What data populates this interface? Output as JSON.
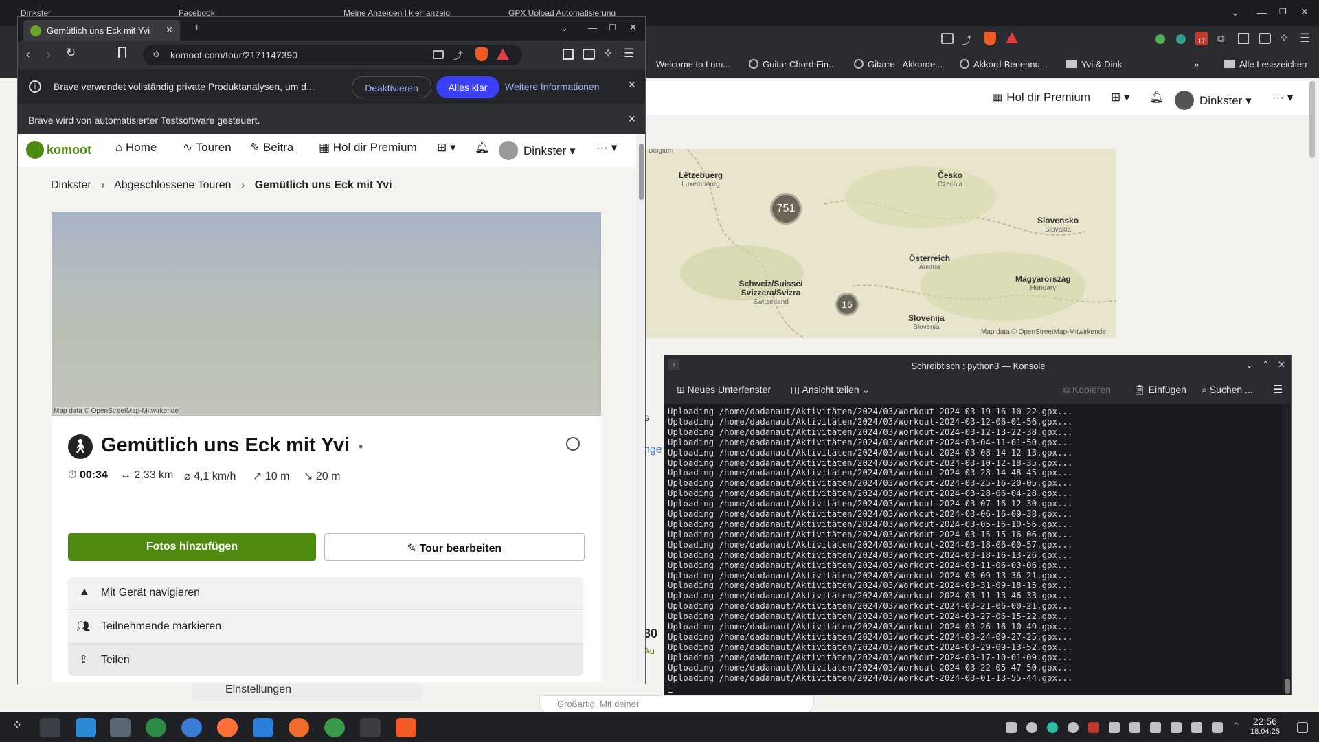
{
  "bg_browser": {
    "tabs": [
      "Dinkster",
      "Facebook",
      "Meine Anzeigen | kleinanzeig",
      "GPX Upload Automatisierung"
    ],
    "bookmarks": [
      "Welcome to Lum...",
      "Guitar Chord Fin...",
      "Gitarre - Akkorde...",
      "Akkord-Benennu...",
      "Yvi & Dink",
      "Alle Lesezeichen"
    ],
    "header": {
      "premium": "Hol dir Premium",
      "user": "Dinkster"
    },
    "map": {
      "countries": [
        {
          "name": "Lëtzebuerg",
          "sub": "Luxembourg"
        },
        {
          "name": "Česko",
          "sub": "Czechia"
        },
        {
          "name": "Slovensko",
          "sub": "Slovakia"
        },
        {
          "name": "Österreich",
          "sub": "Austria"
        },
        {
          "name": "Magyarország",
          "sub": "Hungary"
        },
        {
          "name": "Schweiz/Suisse/ Svizzera/Svizra",
          "sub": "Switzerland"
        },
        {
          "name": "Slovenija",
          "sub": "Slovenia"
        },
        {
          "name": "",
          "sub": "Belgium"
        }
      ],
      "clusters": [
        "751",
        "16"
      ],
      "attribution": "Map data © OpenStreetMap-Mitwirkende"
    },
    "partial": {
      "s": "s",
      "nge": "nge",
      "n30": "30",
      "au": "Au",
      "einstellungen": "Einstellungen",
      "grossartig": "Großartig. Mit deiner"
    }
  },
  "fg_browser": {
    "tab_title": "Gemütlich uns Eck mit Yvi",
    "url": "komoot.com/tour/2171147390",
    "badge": "",
    "info_bar": {
      "text": "Brave verwendet vollständig private Produktanalysen, um d...",
      "deactivate": "Deaktivieren",
      "ok": "Alles klar",
      "more": "Weitere Informationen"
    },
    "automation_bar": "Brave wird von automatisierter Testsoftware gesteuert.",
    "nav": {
      "brand": "komoot",
      "home": "Home",
      "tours": "Touren",
      "posts": "Beitra",
      "premium": "Hol dir Premium",
      "user": "Dinkster"
    },
    "breadcrumb": [
      "Dinkster",
      "Abgeschlossene Touren",
      "Gemütlich uns Eck mit Yvi"
    ],
    "map_attribution": "Map data © OpenStreetMap-Mitwirkende",
    "tour": {
      "title": "Gemütlich uns Eck mit Yvi",
      "duration": "00:34",
      "distance": "2,33 km",
      "speed": "4,1 km/h",
      "up": "10 m",
      "down": "20 m"
    },
    "buttons": {
      "add_photos": "Fotos hinzufügen",
      "edit_tour": "Tour bearbeiten"
    },
    "actions": [
      "Mit Gerät navigieren",
      "Teilnehmende markieren",
      "Teilen"
    ]
  },
  "konsole": {
    "title": "Schreibtisch : python3 — Konsole",
    "toolbar": {
      "new_tab": "Neues Unterfenster",
      "split": "Ansicht teilen",
      "copy": "Kopieren",
      "paste": "Einfügen",
      "search": "Suchen ..."
    },
    "lines": [
      "Uploading /home/dadanaut/Aktivitäten/2024/03/Workout-2024-03-19-16-10-22.gpx...",
      "Uploading /home/dadanaut/Aktivitäten/2024/03/Workout-2024-03-12-06-01-56.gpx...",
      "Uploading /home/dadanaut/Aktivitäten/2024/03/Workout-2024-03-12-13-22-38.gpx...",
      "Uploading /home/dadanaut/Aktivitäten/2024/03/Workout-2024-03-04-11-01-50.gpx...",
      "Uploading /home/dadanaut/Aktivitäten/2024/03/Workout-2024-03-08-14-12-13.gpx...",
      "Uploading /home/dadanaut/Aktivitäten/2024/03/Workout-2024-03-10-12-18-35.gpx...",
      "Uploading /home/dadanaut/Aktivitäten/2024/03/Workout-2024-03-28-14-48-45.gpx...",
      "Uploading /home/dadanaut/Aktivitäten/2024/03/Workout-2024-03-25-16-20-05.gpx...",
      "Uploading /home/dadanaut/Aktivitäten/2024/03/Workout-2024-03-28-06-04-28.gpx...",
      "Uploading /home/dadanaut/Aktivitäten/2024/03/Workout-2024-03-07-16-12-30.gpx...",
      "Uploading /home/dadanaut/Aktivitäten/2024/03/Workout-2024-03-06-16-09-38.gpx...",
      "Uploading /home/dadanaut/Aktivitäten/2024/03/Workout-2024-03-05-16-10-56.gpx...",
      "Uploading /home/dadanaut/Aktivitäten/2024/03/Workout-2024-03-15-15-16-06.gpx...",
      "Uploading /home/dadanaut/Aktivitäten/2024/03/Workout-2024-03-18-06-00-57.gpx...",
      "Uploading /home/dadanaut/Aktivitäten/2024/03/Workout-2024-03-18-16-13-26.gpx...",
      "Uploading /home/dadanaut/Aktivitäten/2024/03/Workout-2024-03-11-06-03-06.gpx...",
      "Uploading /home/dadanaut/Aktivitäten/2024/03/Workout-2024-03-09-13-36-21.gpx...",
      "Uploading /home/dadanaut/Aktivitäten/2024/03/Workout-2024-03-31-09-18-15.gpx...",
      "Uploading /home/dadanaut/Aktivitäten/2024/03/Workout-2024-03-11-13-46-33.gpx...",
      "Uploading /home/dadanaut/Aktivitäten/2024/03/Workout-2024-03-21-06-00-21.gpx...",
      "Uploading /home/dadanaut/Aktivitäten/2024/03/Workout-2024-03-27-06-15-22.gpx...",
      "Uploading /home/dadanaut/Aktivitäten/2024/03/Workout-2024-03-26-16-10-49.gpx...",
      "Uploading /home/dadanaut/Aktivitäten/2024/03/Workout-2024-03-24-09-27-25.gpx...",
      "Uploading /home/dadanaut/Aktivitäten/2024/03/Workout-2024-03-29-09-13-52.gpx...",
      "Uploading /home/dadanaut/Aktivitäten/2024/03/Workout-2024-03-17-10-01-09.gpx...",
      "Uploading /home/dadanaut/Aktivitäten/2024/03/Workout-2024-03-22-05-47-50.gpx...",
      "Uploading /home/dadanaut/Aktivitäten/2024/03/Workout-2024-03-01-13-55-44.gpx..."
    ]
  },
  "taskbar": {
    "time": "22:56",
    "date": "18.04.25",
    "bookmark_count": "17"
  },
  "colors": {
    "komoot_green": "#4f8a10",
    "brave_blue": "#3b3ff5",
    "terminal_bg": "#1a1b1e"
  }
}
